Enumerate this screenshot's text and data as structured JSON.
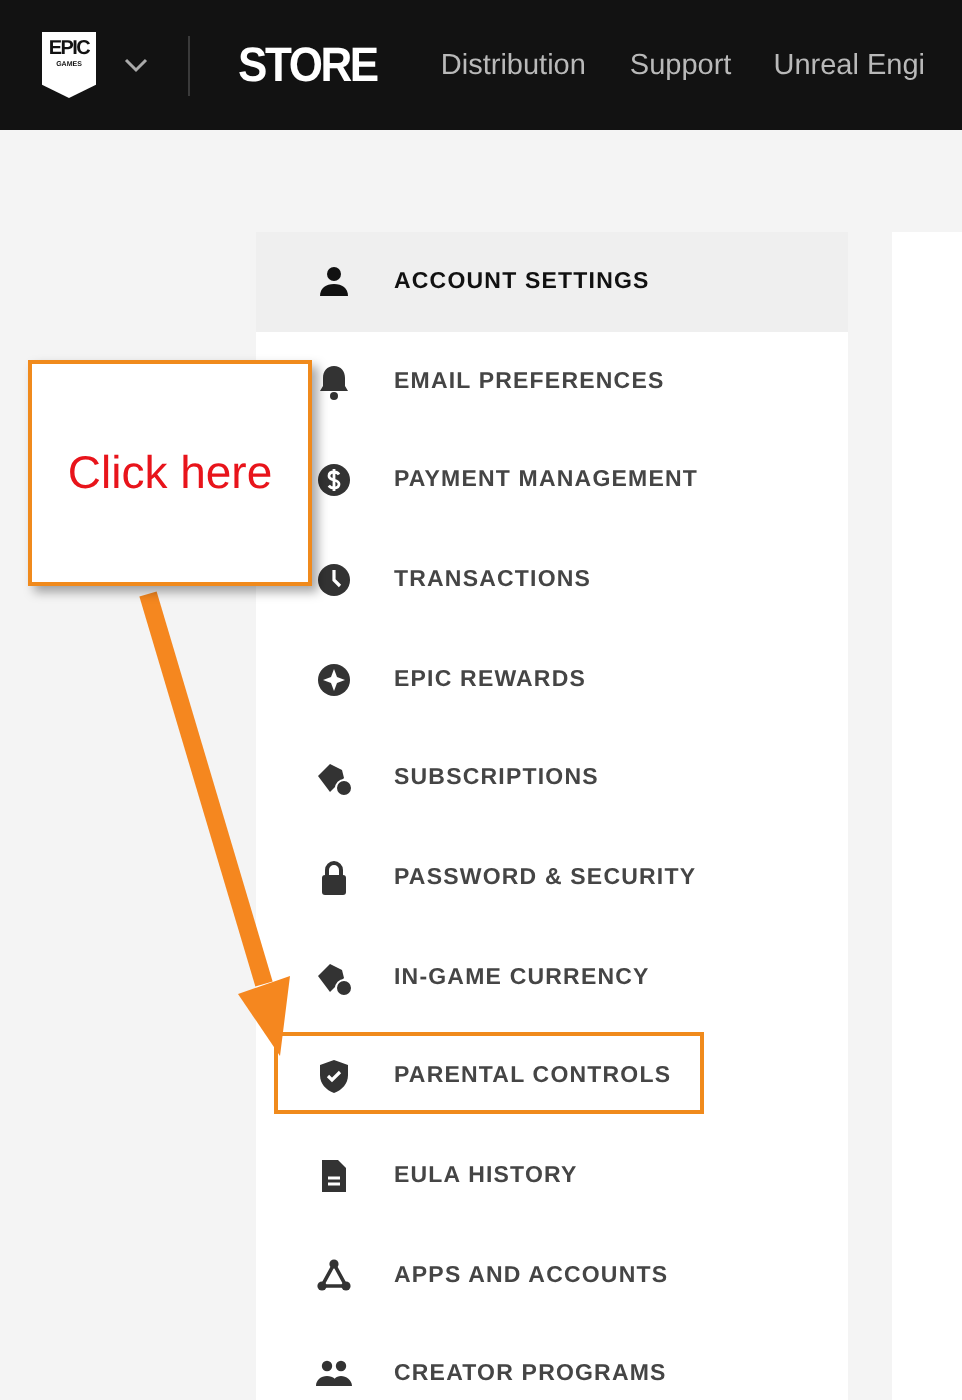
{
  "header": {
    "logo": {
      "line1": "EPIC",
      "line2": "GAMES"
    },
    "brand": "STORE",
    "nav": [
      {
        "label": "Distribution"
      },
      {
        "label": "Support"
      },
      {
        "label": "Unreal Engi"
      }
    ]
  },
  "sidebar": {
    "items": [
      {
        "label": "ACCOUNT SETTINGS",
        "selected": true,
        "annotated": false
      },
      {
        "label": "EMAIL PREFERENCES",
        "selected": false,
        "annotated": false
      },
      {
        "label": "PAYMENT MANAGEMENT",
        "selected": false,
        "annotated": false
      },
      {
        "label": "TRANSACTIONS",
        "selected": false,
        "annotated": false
      },
      {
        "label": "EPIC REWARDS",
        "selected": false,
        "annotated": false
      },
      {
        "label": "SUBSCRIPTIONS",
        "selected": false,
        "annotated": false
      },
      {
        "label": "PASSWORD & SECURITY",
        "selected": false,
        "annotated": false
      },
      {
        "label": "IN-GAME CURRENCY",
        "selected": false,
        "annotated": false
      },
      {
        "label": "PARENTAL CONTROLS",
        "selected": false,
        "annotated": true
      },
      {
        "label": "EULA HISTORY",
        "selected": false,
        "annotated": false
      },
      {
        "label": "APPS AND ACCOUNTS",
        "selected": false,
        "annotated": false
      },
      {
        "label": "CREATOR PROGRAMS",
        "selected": false,
        "annotated": false
      }
    ]
  },
  "callout": {
    "text": "Click here"
  }
}
